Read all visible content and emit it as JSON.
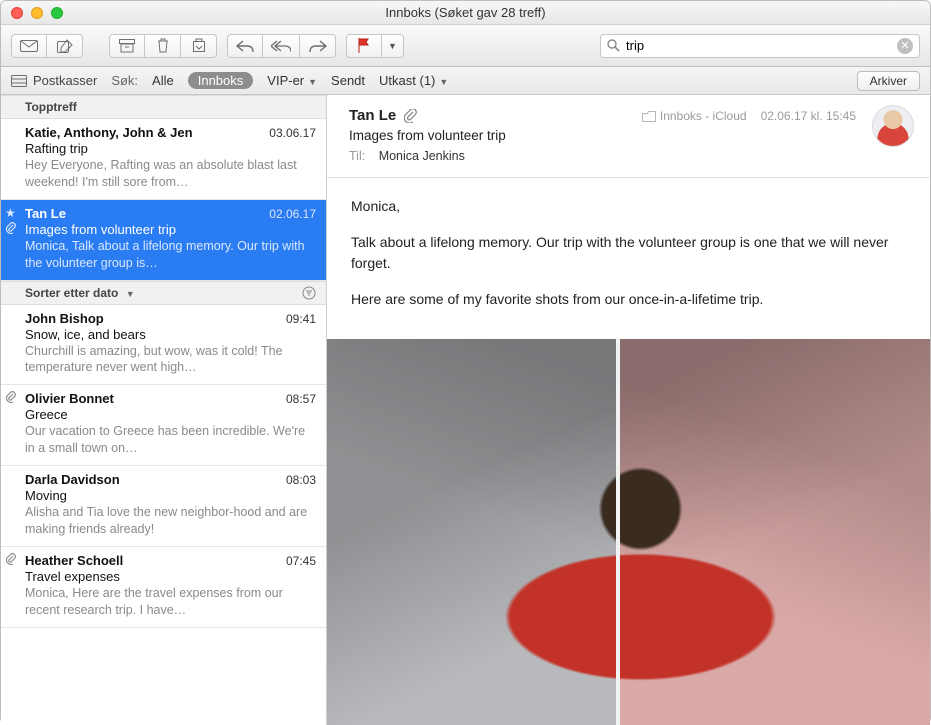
{
  "window": {
    "title": "Innboks (Søket gav 28 treff)"
  },
  "search": {
    "value": "trip",
    "placeholder": "Søk"
  },
  "scope": {
    "mailboxes_label": "Postkasser",
    "search_label": "Søk:",
    "items": [
      {
        "label": "Alle"
      },
      {
        "label": "Innboks"
      },
      {
        "label": "VIP-er"
      },
      {
        "label": "Sendt"
      },
      {
        "label": "Utkast (1)"
      }
    ],
    "archive_label": "Arkiver"
  },
  "list": {
    "top_header": "Topptreff",
    "sort_header": "Sorter etter dato",
    "messages_top": [
      {
        "sender": "Katie, Anthony, John & Jen",
        "date": "03.06.17",
        "subject": "Rafting trip",
        "preview": "Hey Everyone, Rafting was an absolute blast last weekend! I'm still sore from…",
        "has_attachment": false,
        "starred": false
      },
      {
        "sender": "Tan Le",
        "date": "02.06.17",
        "subject": "Images from volunteer trip",
        "preview": "Monica, Talk about a lifelong memory. Our trip with the volunteer group is…",
        "has_attachment": true,
        "starred": true,
        "selected": true
      }
    ],
    "messages_rest": [
      {
        "sender": "John Bishop",
        "date": "09:41",
        "subject": "Snow, ice, and bears",
        "preview": "Churchill is amazing, but wow, was it cold! The temperature never went high…",
        "has_attachment": false
      },
      {
        "sender": "Olivier Bonnet",
        "date": "08:57",
        "subject": "Greece",
        "preview": "Our vacation to Greece has been incredible. We're in a small town on…",
        "has_attachment": true
      },
      {
        "sender": "Darla Davidson",
        "date": "08:03",
        "subject": "Moving",
        "preview": "Alisha and Tia love the new neighbor-hood and are making friends already!",
        "has_attachment": false
      },
      {
        "sender": "Heather Schoell",
        "date": "07:45",
        "subject": "Travel expenses",
        "preview": "Monica, Here are the travel expenses from our recent research trip. I have…",
        "has_attachment": true
      }
    ]
  },
  "reader": {
    "from": "Tan Le",
    "folder": "Innboks - iCloud",
    "datetime": "02.06.17 kl. 15:45",
    "subject": "Images from volunteer trip",
    "to_label": "Til:",
    "to_value": "Monica Jenkins",
    "body_p1": "Monica,",
    "body_p2": "Talk about a lifelong memory. Our trip with the volunteer group is one that we will never forget.",
    "body_p3": "Here are some of my favorite shots from our once-in-a-lifetime trip."
  }
}
